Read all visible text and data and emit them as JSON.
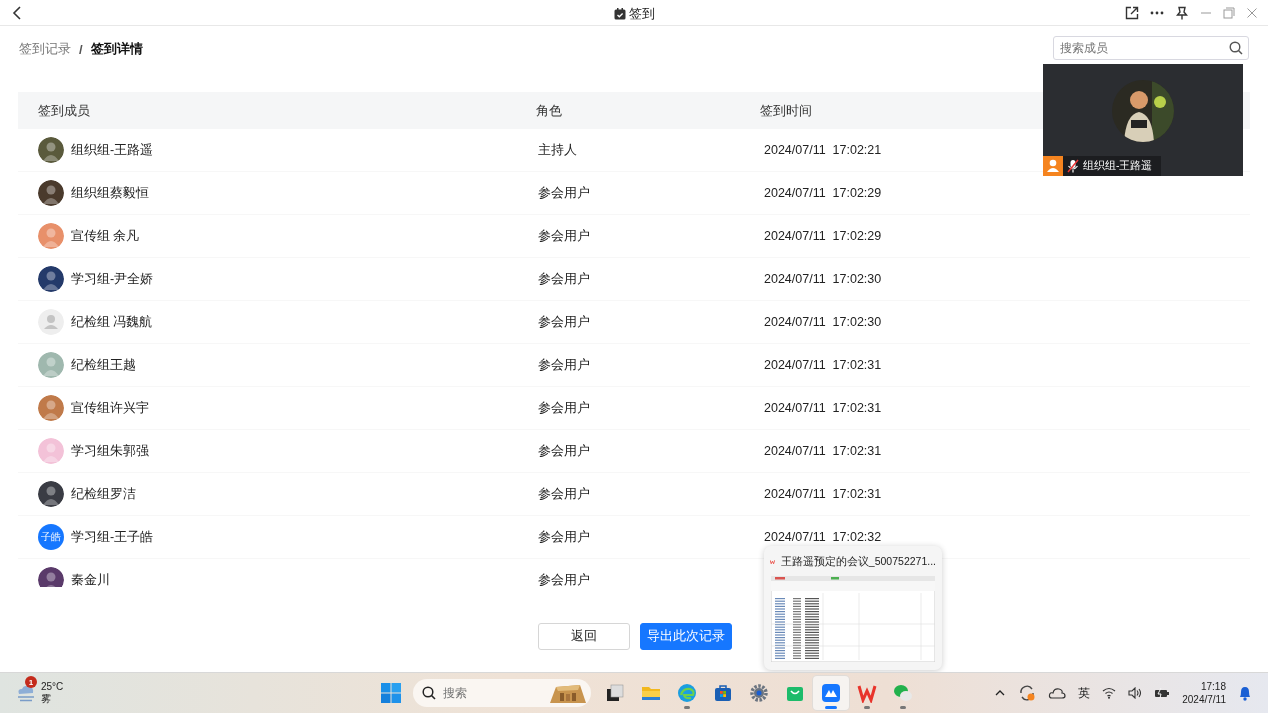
{
  "window": {
    "title": "签到"
  },
  "breadcrumb_separator": "/",
  "breadcrumb": [
    {
      "label": "签到记录",
      "selected": false
    },
    {
      "label": "签到详情",
      "selected": true
    }
  ],
  "search": {
    "placeholder": "搜索成员"
  },
  "table": {
    "columns": [
      "签到成员",
      "角色",
      "签到时间"
    ],
    "rows": [
      {
        "name": "组织组-王路遥",
        "role": "主持人",
        "time": "2024/07/11  17:02:21"
      },
      {
        "name": "组织组蔡毅恒",
        "role": "参会用户",
        "time": "2024/07/11  17:02:29"
      },
      {
        "name": "宣传组 余凡",
        "role": "参会用户",
        "time": "2024/07/11  17:02:29"
      },
      {
        "name": "学习组-尹全娇",
        "role": "参会用户",
        "time": "2024/07/11  17:02:30"
      },
      {
        "avatar": {
          "kind": "default",
          "color": "#eeeeee"
        },
        "name": "纪检组 冯魏航",
        "role": "参会用户",
        "time": "2024/07/11  17:02:30"
      },
      {
        "name": "纪检组王越",
        "role": "参会用户",
        "time": "2024/07/11  17:02:31"
      },
      {
        "name": "宣传组许兴宇",
        "role": "参会用户",
        "time": "2024/07/11  17:02:31"
      },
      {
        "name": "学习组朱郭强",
        "role": "参会用户",
        "time": "2024/07/11  17:02:31"
      },
      {
        "name": "纪检组罗洁",
        "role": "参会用户",
        "time": "2024/07/11  17:02:31"
      },
      {
        "avatar": {
          "kind": "text",
          "color": "#1677ff",
          "text": "子皓"
        },
        "name": "学习组-王子皓",
        "role": "参会用户",
        "time": "2024/07/11  17:02:32"
      },
      {
        "name": "秦金川",
        "role": "参会用户"
      }
    ]
  },
  "buttons": [
    {
      "label": "返回",
      "kind": "secondary"
    },
    {
      "label": "导出此次记录",
      "kind": "primary"
    }
  ],
  "video_tile": {
    "name": "组织组-王路遥",
    "mic_muted": true
  },
  "preview_popup": {
    "title": "王路遥预定的会议_500752271..."
  },
  "taskbar": {
    "weather": {
      "badge": "1",
      "temperature": "25°C",
      "condition": "雾"
    },
    "search": {
      "placeholder": "搜索"
    },
    "apps": [
      {
        "kind": "taskview",
        "selected": false,
        "running": false
      },
      {
        "kind": "folder",
        "selected": false,
        "running": false
      },
      {
        "kind": "browser",
        "selected": false,
        "running": true
      },
      {
        "kind": "store",
        "selected": false,
        "running": false
      },
      {
        "kind": "settings",
        "selected": false,
        "running": false
      },
      {
        "kind": "bag",
        "selected": false,
        "running": false
      },
      {
        "kind": "meeting",
        "selected": true,
        "running": true
      },
      {
        "kind": "wps",
        "selected": false,
        "running": true
      },
      {
        "kind": "chat",
        "selected": false,
        "running": true
      }
    ],
    "ime": "英",
    "time": "17:18",
    "date": "2024/7/11"
  }
}
